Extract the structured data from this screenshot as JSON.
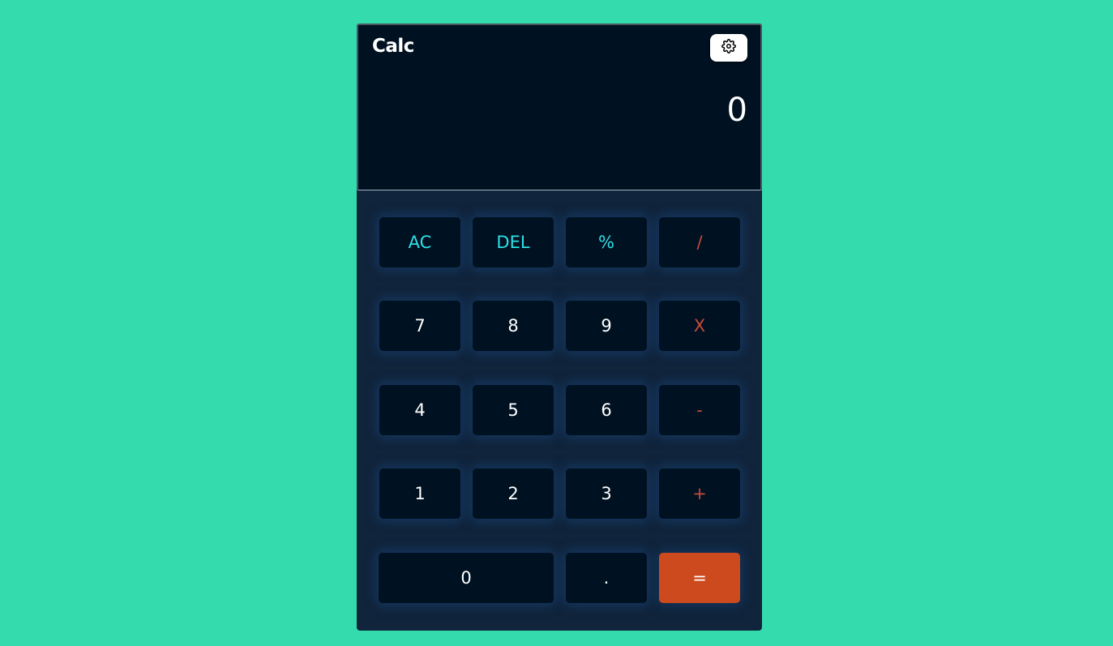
{
  "app": {
    "title": "Calc",
    "settings_icon": "gear-icon",
    "display_value": "0"
  },
  "keypad": {
    "row1": [
      "AC",
      "DEL",
      "%",
      "/"
    ],
    "row2": [
      "7",
      "8",
      "9",
      "X"
    ],
    "row3": [
      "4",
      "5",
      "6",
      "-"
    ],
    "row4": [
      "1",
      "2",
      "3",
      "+"
    ],
    "row5": [
      "0",
      ".",
      "="
    ]
  },
  "colors": {
    "background": "#34dcad",
    "screen": "#001121",
    "keypad": "#10243b",
    "key": "#001121",
    "function_text": "#2ee0e6",
    "operator_text": "#c84a3c",
    "equals_button": "#cc4a1e"
  }
}
